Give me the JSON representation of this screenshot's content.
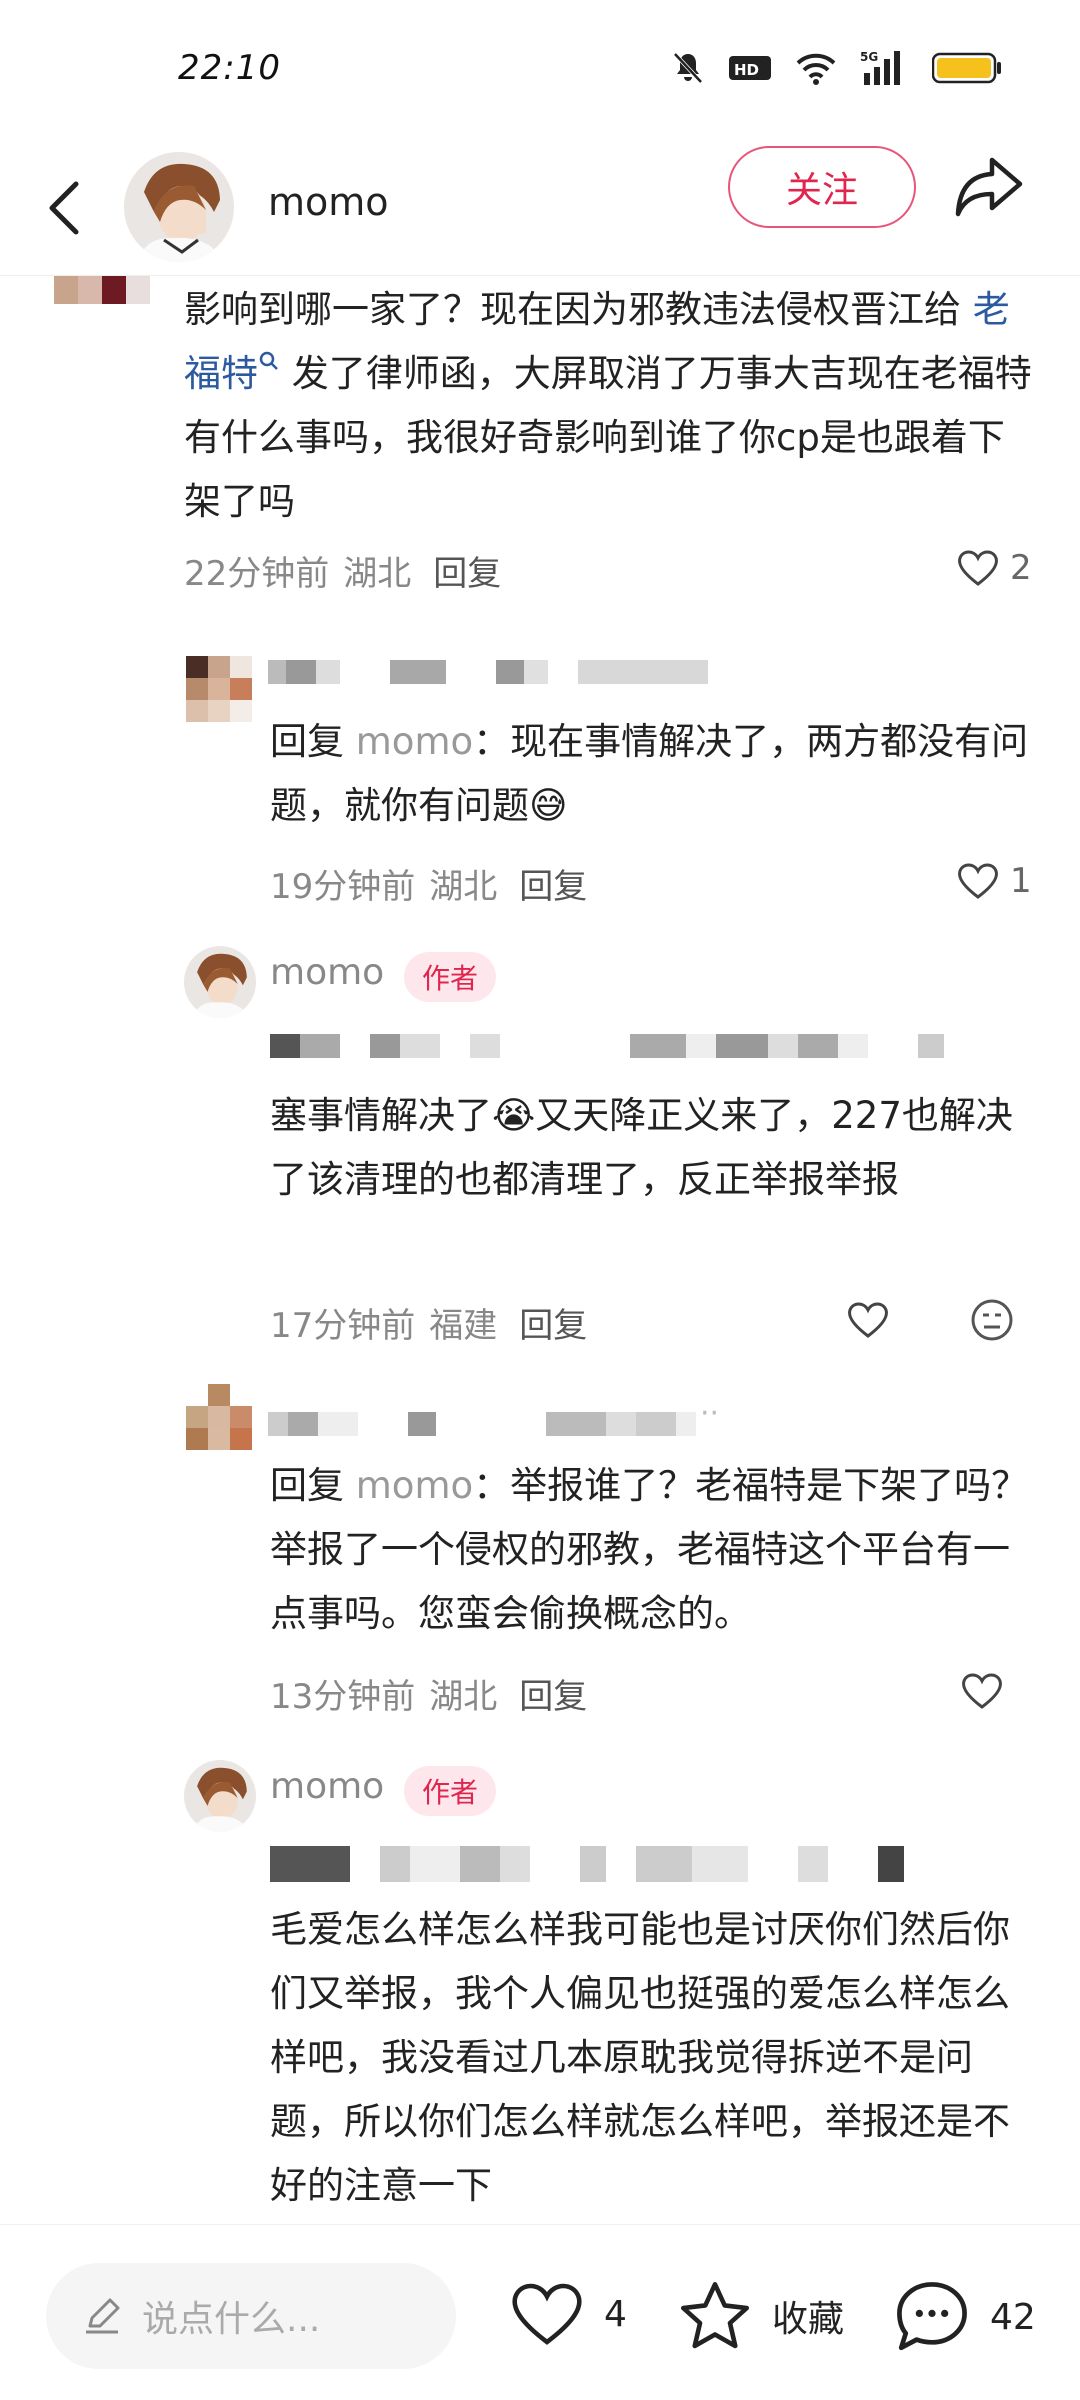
{
  "status": {
    "time": "22:10"
  },
  "header": {
    "username": "momo",
    "follow_label": "关注"
  },
  "comments": [
    {
      "text_pre": "影响到哪一家了？现在因为邪教违法侵权晋江给 ",
      "link": "老福特",
      "text_post": " 发了律师函，大屏取消了万事大吉现在老福特有什么事吗，我很好奇影响到谁了你cp是也跟着下架了吗",
      "time": "22分钟前",
      "location": "湖北",
      "reply_label": "回复",
      "likes": "2"
    },
    {
      "prefix": "回复 ",
      "mention": "momo",
      "text": "：现在事情解决了，两方都没有问题，就你有问题",
      "emoji": "😅",
      "time": "19分钟前",
      "location": "湖北",
      "reply_label": "回复",
      "likes": "1"
    },
    {
      "author": "momo",
      "tag": "作者",
      "text_a": "塞事情解决了",
      "emoji": "😭",
      "text_b": "又天降正义来了，227也解决了该清理的也都清理了，反正举报举报",
      "time": "17分钟前",
      "location": "福建",
      "reply_label": "回复"
    },
    {
      "prefix": "回复 ",
      "mention": "momo",
      "text": "：举报谁了？老福特是下架了吗？举报了一个侵权的邪教，老福特这个平台有一点事吗。您蛮会偷换概念的。",
      "time": "13分钟前",
      "location": "湖北",
      "reply_label": "回复"
    },
    {
      "author": "momo",
      "tag": "作者",
      "text": "毛爱怎么样怎么样我可能也是讨厌你们然后你们又举报，我个人偏见也挺强的爱怎么样怎么样吧，我没看过几本原耽我觉得拆逆不是问题，所以你们怎么样就怎么样吧，举报还是不好的注意一下"
    }
  ],
  "bottom": {
    "input_placeholder": "说点什么...",
    "likes": "4",
    "collect_label": "收藏",
    "comments": "42"
  }
}
